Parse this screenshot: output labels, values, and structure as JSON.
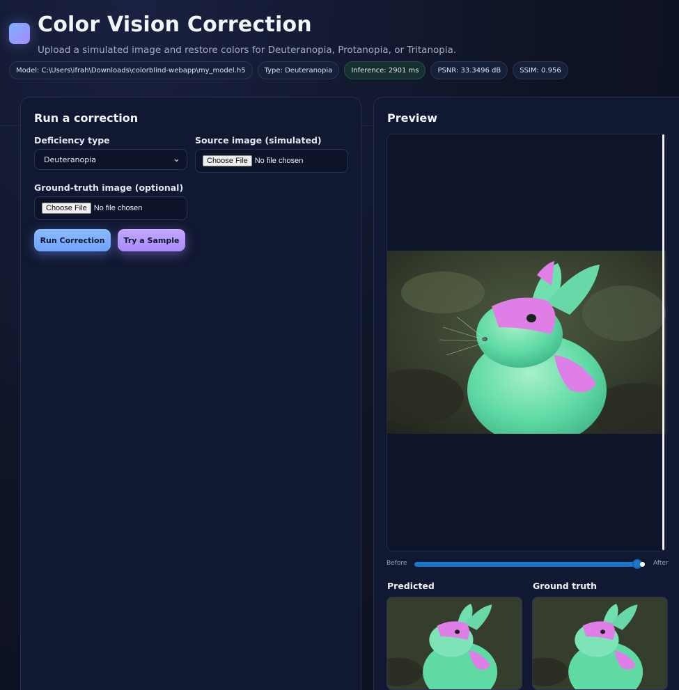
{
  "header": {
    "title": "Color Vision Correction",
    "subtitle": "Upload a simulated image and restore colors for Deuteranopia, Protanopia, or Tritanopia.",
    "badges": {
      "model": "Model: C:\\Users\\ifrah\\Downloads\\colorblind-webapp\\my_model.h5",
      "type": "Type: Deuteranopia",
      "inference": "Inference: 2901 ms",
      "psnr": "PSNR: 33.3496 dB",
      "ssim": "SSIM: 0.956"
    }
  },
  "form": {
    "title": "Run a correction",
    "deficiency_label": "Deficiency type",
    "deficiency_value": "Deuteranopia",
    "source_label": "Source image (simulated)",
    "ground_truth_label": "Ground-truth image (optional)",
    "choose_file": "Choose File",
    "no_file": "No file chosen",
    "run_button": "Run Correction",
    "sample_button": "Try a Sample"
  },
  "preview": {
    "title": "Preview",
    "before_label": "Before",
    "after_label": "After",
    "slider_value": 0.97,
    "predicted_label": "Predicted",
    "ground_truth_label": "Ground truth"
  },
  "colors": {
    "accent_blue": "#6fa2ff",
    "accent_purple": "#a78bfa",
    "background": "#0f1426"
  },
  "icons": {
    "logo": "app-logo-icon",
    "select_arrow": "chevron-down-icon"
  }
}
